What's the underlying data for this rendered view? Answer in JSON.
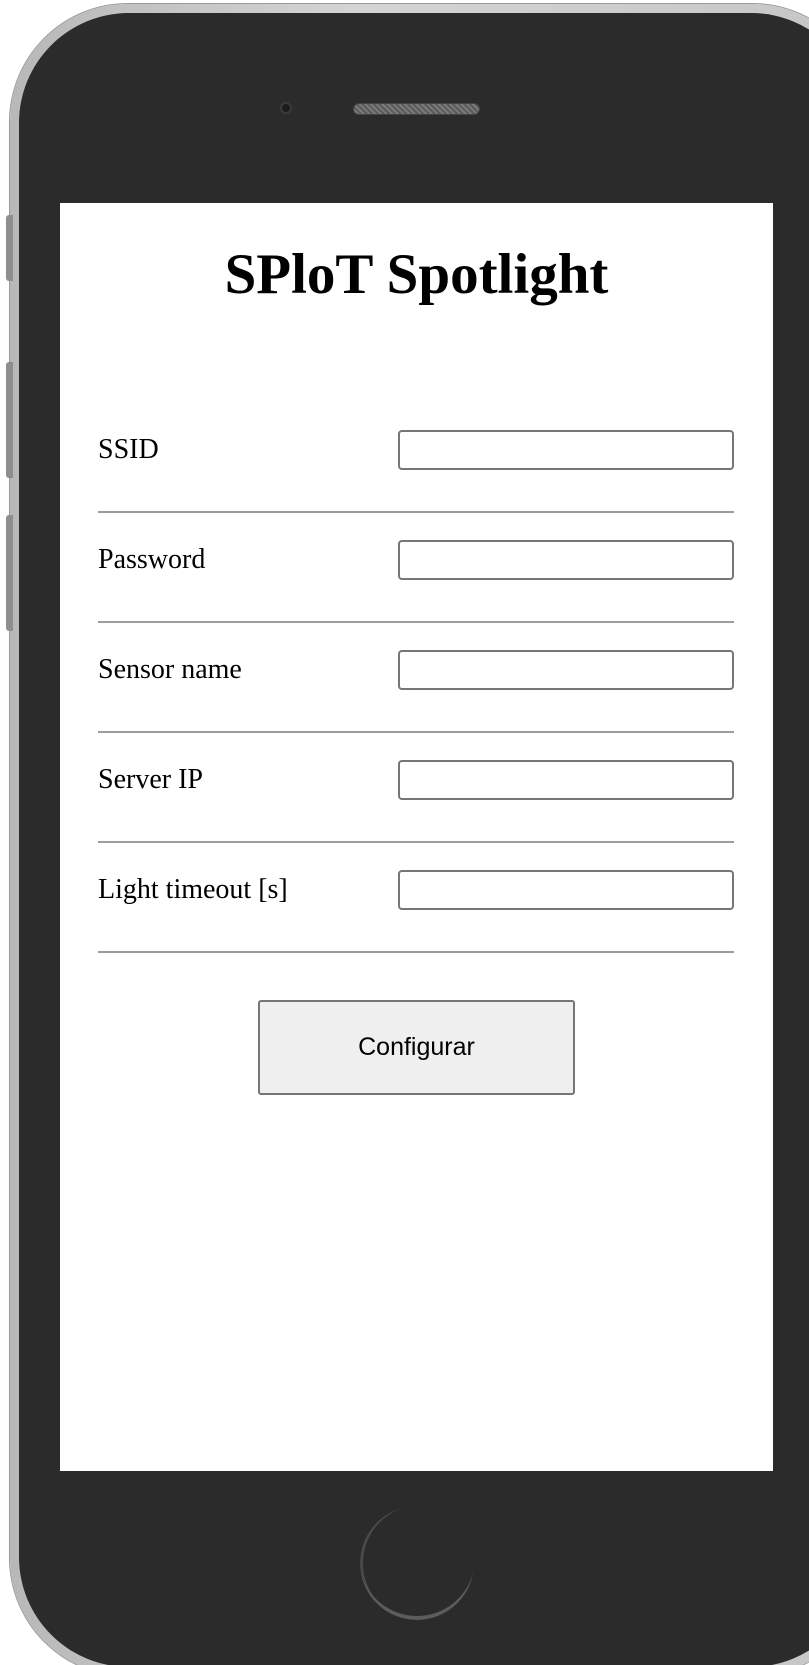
{
  "app": {
    "title": "SPloT Spotlight"
  },
  "form": {
    "fields": [
      {
        "label": "SSID",
        "value": "",
        "type": "text"
      },
      {
        "label": "Password",
        "value": "",
        "type": "password"
      },
      {
        "label": "Sensor name",
        "value": "",
        "type": "text"
      },
      {
        "label": "Server IP",
        "value": "",
        "type": "text"
      },
      {
        "label": "Light timeout [s]",
        "value": "",
        "type": "text"
      }
    ],
    "submit_label": "Configurar"
  },
  "colors": {
    "phone_body": "#2b2b2b",
    "phone_rim": "#c6c6c6",
    "screen_bg": "#ffffff",
    "divider": "#9c9c9c",
    "button_bg": "#efefef"
  },
  "icons": {
    "camera": "camera-icon",
    "speaker": "speaker-grille-icon",
    "home": "home-button-icon"
  }
}
